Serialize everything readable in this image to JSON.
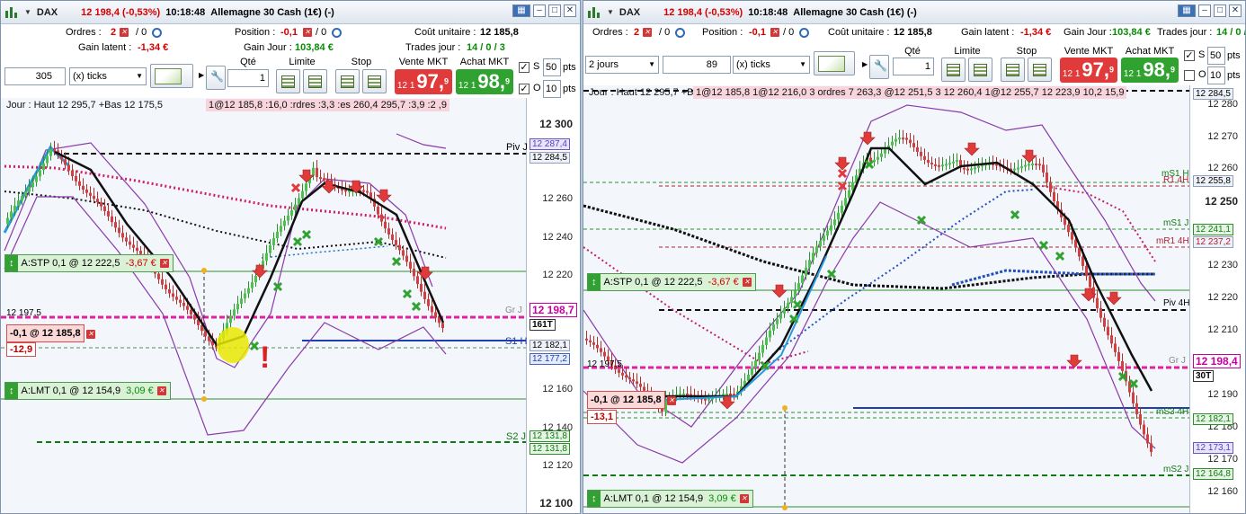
{
  "left": {
    "title": {
      "symbol": "DAX",
      "price": "12 198,4 (-0,53%)",
      "time": "10:18:48",
      "name": "Allemagne 30 Cash (1€) (-)"
    },
    "info": {
      "orders_label": "Ordres :",
      "orders_val": "2",
      "orders_zero": "/ 0",
      "position_label": "Position :",
      "position_val": "-0,1",
      "position_zero": "/ 0",
      "cost_label": "Coût unitaire :",
      "cost_val": "12 185,8",
      "latent_label": "Gain latent :",
      "latent_val": "-1,34 €",
      "gainday_label": "Gain Jour :",
      "gainday_val": "103,84 €",
      "trades_label": "Trades jour :",
      "trades_val": "14 / 0 / 3"
    },
    "toolbar": {
      "period": "305",
      "unit": "(x) ticks",
      "qty_label": "Qté",
      "qty": "1",
      "limit_label": "Limite",
      "stop_label": "Stop",
      "sell_label": "Vente MKT",
      "sell_prefix": "12 1",
      "sell_big": "97,",
      "sell_sup": "9",
      "buy_label": "Achat MKT",
      "buy_prefix": "12 1",
      "buy_big": "98,",
      "buy_sup": "9",
      "s_label": "S",
      "s_val": "50",
      "o_label": "O",
      "o_val": "10",
      "pts": "pts"
    },
    "legend": "Jour : Haut 12 295,7 +Bas 12 175,5",
    "legend_orders": "1@12 185,8 :16,0 :rdres :3,3 :es 260,4 295,7 :3,9 :2 ,9",
    "ticks": [
      "12 300",
      "12 260",
      "12 240",
      "12 220",
      "12 160",
      "12 140",
      "12 120",
      "12 100"
    ],
    "tags": {
      "pivj": "12 287,4",
      "hautj": "12 284,5",
      "price": "12 198,7",
      "vol": "161T",
      "s1": "12 182,1",
      "x1": "12 177,2",
      "s2a": "12 131,8",
      "s2b": "12 131,8"
    },
    "line_labels": {
      "piv": "Piv J",
      "s1h": "S1 H",
      "s2j": "S2 J",
      "gr": "Gr J",
      "level": "12 197,5"
    },
    "orders": {
      "stp": "A:STP  0,1 @ 12 222,5",
      "stp_pnl": "-3,67 €",
      "pos": "-0,1 @ 12 185,8",
      "pos_pnl": "-12,9",
      "lmt": "A:LMT  0,1 @ 12 154,9",
      "lmt_pnl": "3,09 €"
    }
  },
  "right": {
    "title": {
      "symbol": "DAX",
      "price": "12 198,4 (-0,53%)",
      "time": "10:18:48",
      "name": "Allemagne 30 Cash (1€) (-)"
    },
    "info": {
      "orders_label": "Ordres :",
      "orders_val": "2",
      "orders_zero": "/ 0",
      "position_label": "Position :",
      "position_val": "-0,1",
      "position_zero": "/ 0",
      "cost_label": "Coût unitaire :",
      "cost_val": "12 185,8",
      "latent_label": "Gain latent :",
      "latent_val": "-1,34 €",
      "gainday_label": "Gain Jour :",
      "gainday_val": "103,84 €",
      "trades_label": "Trades jour :",
      "trades_val": "14 / 0 / 3"
    },
    "toolbar": {
      "range": "2 jours",
      "period": "89",
      "unit": "(x) ticks",
      "qty_label": "Qté",
      "qty": "1",
      "limit_label": "Limite",
      "stop_label": "Stop",
      "sell_label": "Vente MKT",
      "sell_prefix": "12 1",
      "sell_big": "97,",
      "sell_sup": "9",
      "buy_label": "Achat MKT",
      "buy_prefix": "12 1",
      "buy_big": "98,",
      "buy_sup": "9",
      "s_label": "S",
      "s_val": "50",
      "o_label": "O",
      "o_val": "10",
      "pts": "pts"
    },
    "legend": "Jour : Haut 12 295,7 +Bas 12 175,5",
    "legend_orders": "1@12 185,8 1@12 216,0  3 ordres 7 263,3 @12 251,5 3 12 260,4 1@12 255,7 12 223,9 10,2 15,9",
    "ticks": [
      "12 280",
      "12 270",
      "12 260",
      "12 250",
      "12 230",
      "12 220",
      "12 210",
      "12 190",
      "12 180",
      "12 170",
      "12 160"
    ],
    "tags": {
      "haut": "12 284,5",
      "r1h": "12 255,8",
      "ms1j": "12 241,1",
      "mr1": "12 237,2",
      "price": "12 198,4",
      "vol": "30T",
      "ms1h": "12 182,1",
      "x1": "12 173,1",
      "ms2": "12 164,8"
    },
    "line_labels": {
      "ms1h": "mS1 H",
      "r1h": "R1 4H",
      "ms1j": "mS1 J",
      "mr1": "mR1 4H",
      "piv4": "Piv 4H",
      "gr": "Gr J",
      "ms34": "mS3 4H",
      "ms2j": "mS2 J",
      "level": "12 197,5"
    },
    "orders": {
      "stp": "A:STP  0,1 @ 12 222,5",
      "stp_pnl": "-3,67 €",
      "pos": "-0,1 @ 12 185,8",
      "pos_pnl": "-13,1",
      "lmt": "A:LMT  0,1 @ 12 154,9",
      "lmt_pnl": "3,09 €"
    }
  }
}
